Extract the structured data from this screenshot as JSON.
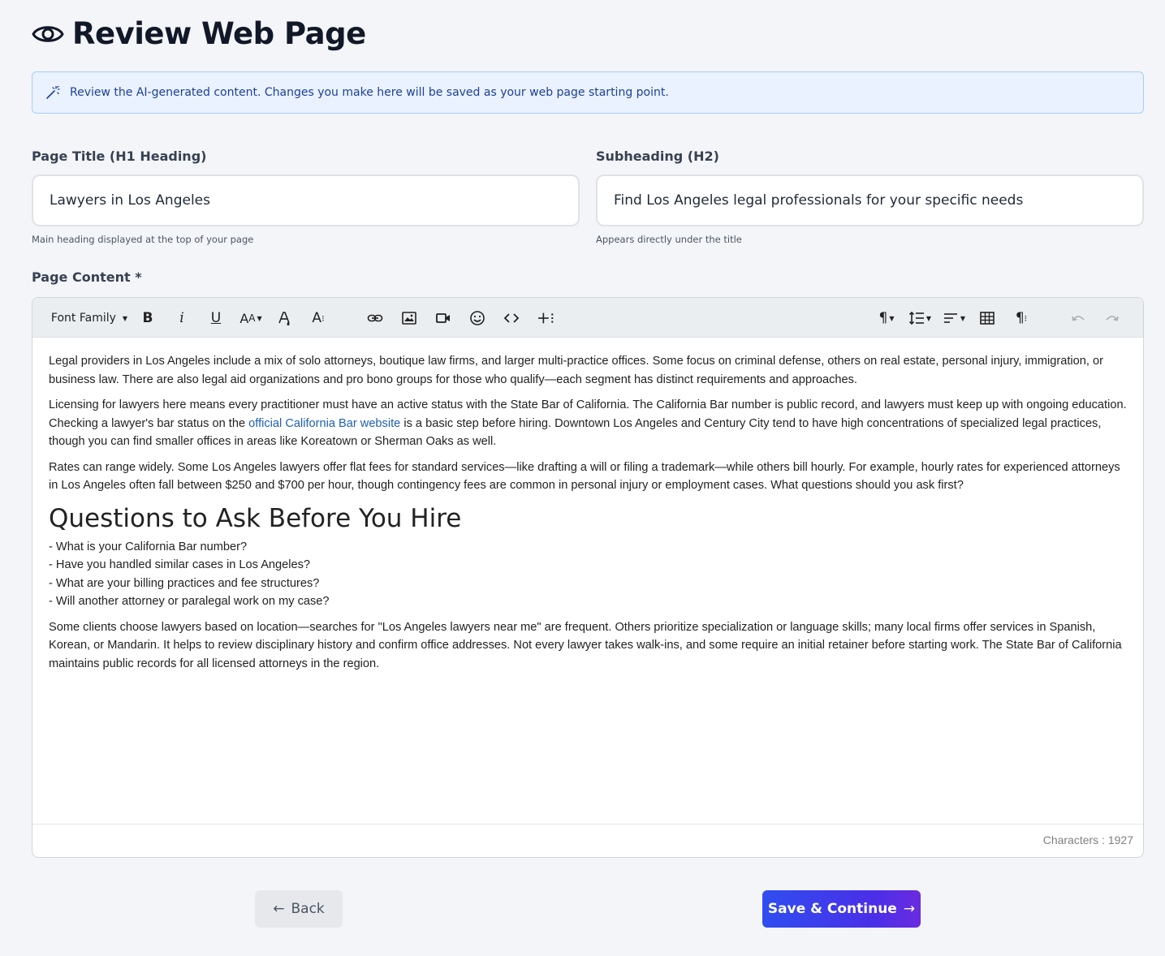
{
  "header": {
    "title": "Review Web Page",
    "icon": "eye-icon"
  },
  "banner": {
    "icon": "magic-wand-icon",
    "text": "Review the AI-generated content. Changes you make here will be saved as your web page starting point."
  },
  "fields": {
    "title": {
      "label": "Page Title (H1 Heading)",
      "value": "Lawyers in Los Angeles",
      "help": "Main heading displayed at the top of your page"
    },
    "subheading": {
      "label": "Subheading (H2)",
      "value": "Find Los Angeles legal professionals for your specific needs",
      "help": "Appears directly under the title"
    }
  },
  "content": {
    "label": "Page Content *",
    "toolbar": {
      "font_family": "Font Family",
      "items": [
        "bold-icon",
        "italic-icon",
        "underline-icon",
        "font-size-icon",
        "text-color-icon",
        "more-text-icon",
        "link-icon",
        "image-icon",
        "video-icon",
        "emoji-icon",
        "code-view-icon",
        "insert-more-icon",
        "paragraph-format-icon",
        "line-height-icon",
        "align-icon",
        "table-icon",
        "more-paragraph-icon",
        "undo-icon",
        "redo-icon"
      ]
    },
    "paragraphs": {
      "p1": "Legal providers in Los Angeles include a mix of solo attorneys, boutique law firms, and larger multi-practice offices. Some focus on criminal defense, others on real estate, personal injury, immigration, or business law. There are also legal aid organizations and pro bono groups for those who qualify—each segment has distinct requirements and approaches.",
      "p2_before": "Licensing for lawyers here means every practitioner must have an active status with the State Bar of California. The California Bar number is public record, and lawyers must keep up with ongoing education. Checking a lawyer's bar status on the ",
      "p2_link": "official California Bar website",
      "p2_after": " is a basic step before hiring. Downtown Los Angeles and Century City tend to have high concentrations of specialized legal practices, though you can find smaller offices in areas like Koreatown or Sherman Oaks as well.",
      "p3": "Rates can range widely. Some Los Angeles lawyers offer flat fees for standard services—like drafting a will or filing a trademark—while others bill hourly. For example, hourly rates for experienced attorneys in Los Angeles often fall between $250 and $700 per hour, though contingency fees are common in personal injury or employment cases. What questions should you ask first?",
      "heading": "Questions to Ask Before You Hire",
      "list": [
        "- What is your California Bar number?",
        "- Have you handled similar cases in Los Angeles?",
        "- What are your billing practices and fee structures?",
        "- Will another attorney or paralegal work on my case?"
      ],
      "p4": "Some clients choose lawyers based on location—searches for \"Los Angeles lawyers near me\" are frequent. Others prioritize specialization or language skills; many local firms offer services in Spanish, Korean, or Mandarin. It helps to review disciplinary history and confirm office addresses. Not every lawyer takes walk-ins, and some require an initial retainer before starting work. The State Bar of California maintains public records for all licensed attorneys in the region."
    },
    "char_count": "Characters : 1927"
  },
  "actions": {
    "back_label": "Back",
    "save_label": "Save & Continue"
  },
  "colors": {
    "accent": "#3b3ff0",
    "banner_bg": "#e9f2fe",
    "link": "#1e5fb4"
  }
}
